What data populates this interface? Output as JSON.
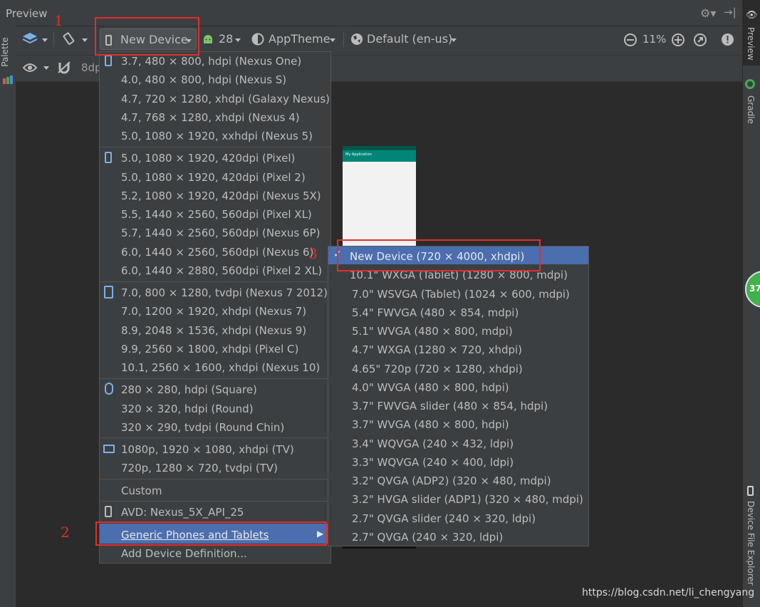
{
  "panel_title": "Preview",
  "toolbar": {
    "device_label": "New Device",
    "api_level": "28",
    "theme": "AppTheme",
    "locale": "Default (en-us)",
    "zoom": "11%",
    "margin": "8dp"
  },
  "right_tools": {
    "preview": "Preview",
    "gradle": "Gradle",
    "device_file_explorer": "Device File Explorer"
  },
  "left_tools": {
    "palette": "Palette"
  },
  "badge_number": "37",
  "phone_app_title": "My Application",
  "device_menu": {
    "group1": [
      "3.7, 480 × 800, hdpi (Nexus One)",
      "4.0, 480 × 800, hdpi (Nexus S)",
      "4.7, 720 × 1280, xhdpi (Galaxy Nexus)",
      "4.7, 768 × 1280, xhdpi (Nexus 4)",
      "5.0, 1080 × 1920, xxhdpi (Nexus 5)"
    ],
    "group2": [
      "5.0, 1080 × 1920, 420dpi (Pixel)",
      "5.0, 1080 × 1920, 420dpi (Pixel 2)",
      "5.2, 1080 × 1920, 420dpi (Nexus 5X)",
      "5.5, 1440 × 2560, 560dpi (Pixel XL)",
      "5.7, 1440 × 2560, 560dpi (Nexus 6P)",
      "6.0, 1440 × 2560, 560dpi (Nexus 6)",
      "6.0, 1440 × 2880, 560dpi (Pixel 2 XL)"
    ],
    "group3": [
      "7.0, 800 × 1280, tvdpi (Nexus 7 2012)",
      "7.0, 1200 × 1920, xhdpi (Nexus 7)",
      "8.9, 2048 × 1536, xhdpi (Nexus 9)",
      "9.9, 2560 × 1800, xhdpi (Pixel C)",
      "10.1, 2560 × 1600, xhdpi (Nexus 10)"
    ],
    "group4": [
      "280 × 280, hdpi (Square)",
      "320 × 320, hdpi (Round)",
      "320 × 290, tvdpi (Round Chin)"
    ],
    "group5": [
      "1080p, 1920 × 1080, xhdpi (TV)",
      "720p, 1280 × 720, tvdpi (TV)"
    ],
    "custom": "Custom",
    "avd": "AVD: Nexus_5X_API_25",
    "generic": "Generic Phones and Tablets",
    "add_definition": "Add Device Definition..."
  },
  "generic_submenu": [
    "New Device (720 × 4000, xhdpi)",
    "10.1\" WXGA (Tablet) (1280 × 800, mdpi)",
    "7.0\" WSVGA (Tablet) (1024 × 600, mdpi)",
    "5.4\" FWVGA (480 × 854, mdpi)",
    "5.1\" WVGA (480 × 800, mdpi)",
    "4.7\" WXGA (1280 × 720, xhdpi)",
    "4.65\" 720p (720 × 1280, xhdpi)",
    "4.0\" WVGA (480 × 800, hdpi)",
    "3.7\" FWVGA slider (480 × 854, hdpi)",
    "3.7\" WVGA (480 × 800, hdpi)",
    "3.4\" WQVGA (240 × 432, ldpi)",
    "3.3\" WQVGA (240 × 400, ldpi)",
    "3.2\" QVGA (ADP2) (320 × 480, mdpi)",
    "3.2\" HVGA slider (ADP1) (320 × 480, mdpi)",
    "2.7\" QVGA slider (240 × 320, ldpi)",
    "2.7\" QVGA (240 × 320, ldpi)"
  ],
  "annotations": {
    "a1": "1",
    "a2": "2",
    "a3": "3"
  },
  "watermark": "https://blog.csdn.net/li_chengyang",
  "colors": {
    "highlight": "#4b6eaf",
    "annotation_red": "#e32d2d",
    "app_bar": "#008577"
  }
}
